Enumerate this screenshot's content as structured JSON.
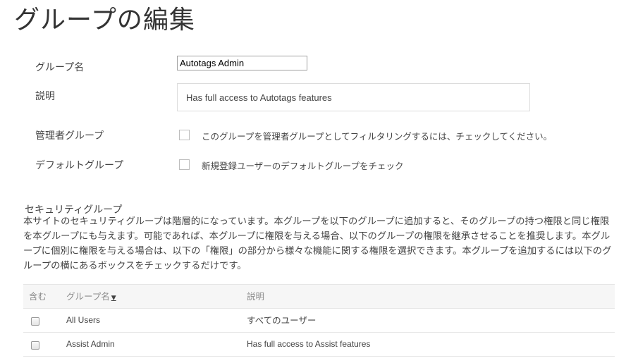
{
  "page": {
    "title": "グループの編集"
  },
  "form": {
    "group_name_label": "グループ名",
    "group_name_value": "Autotags Admin",
    "description_label": "説明",
    "description_value": "Has full access to Autotags features",
    "admin_group_label": "管理者グループ",
    "admin_group_checkbox_text": "このグループを管理者グループとしてフィルタリングするには、チェックしてください。",
    "admin_group_checked": false,
    "default_group_label": "デフォルトグループ",
    "default_group_checkbox_text": "新規登録ユーザーのデフォルトグループをチェック",
    "default_group_checked": false
  },
  "security": {
    "title": "セキュリティグループ",
    "description": "本サイトのセキュリティグループは階層的になっています。本グループを以下のグループに追加すると、そのグループの持つ権限と同じ権限を本グループにも与えます。可能であれば、本グループに権限を与える場合、以下のグループの権限を継承させることを推奨します。本グループに個別に権限を与える場合は、以下の「権限」の部分から様々な機能に関する権限を選択できます。本グループを追加するには以下のグループの横にあるボックスをチェックするだけです。",
    "table": {
      "headers": {
        "include": "含む",
        "group_name": "グループ名",
        "description": "説明"
      },
      "sort_icon": "sort-down-arrow",
      "rows": [
        {
          "name": "All Users",
          "description": "すべてのユーザー",
          "checked": false
        },
        {
          "name": "Assist Admin",
          "description": "Has full access to Assist features",
          "checked": false
        }
      ]
    }
  }
}
